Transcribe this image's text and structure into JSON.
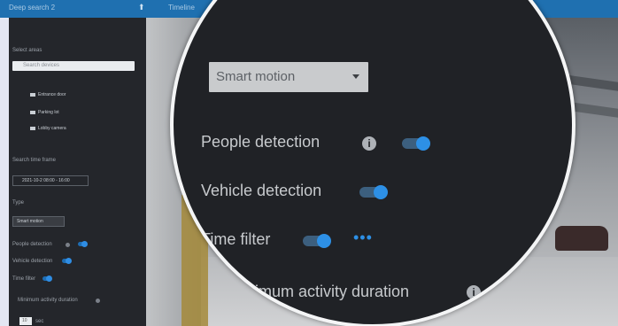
{
  "topbar": {
    "title": "Deep search 2",
    "tab": "Timeline"
  },
  "sidebar": {
    "select_areas_label": "Select areas",
    "search_placeholder": "Search devices",
    "cameras": [
      "Entrance door",
      "Parking lot",
      "Lobby camera"
    ],
    "search_time_label": "Search time frame",
    "date_value": "2021-10-2 08:00 - 16:00",
    "type_label": "Type",
    "type_value": "Smart motion",
    "people_label": "People detection",
    "vehicle_label": "Vehicle detection",
    "time_filter_label": "Time filter",
    "min_duration_label": "Minimum activity duration",
    "min_duration_value": "10",
    "min_duration_unit": "sec"
  },
  "panel": {
    "type_select": "Smart motion",
    "people_detection": "People detection",
    "vehicle_detection": "Vehicle detection",
    "time_filter": "Time filter",
    "minimum_activity": "Minimum activity duration",
    "info_glyph": "i",
    "more_glyph": "•••"
  },
  "colors": {
    "accent": "#2d90e6",
    "topbar": "#1f70b0",
    "panel_bg": "#202226"
  },
  "icons": [
    "pin-icon",
    "camera-icon",
    "calendar-icon",
    "info-icon",
    "chevron-down-icon",
    "more-icon"
  ]
}
